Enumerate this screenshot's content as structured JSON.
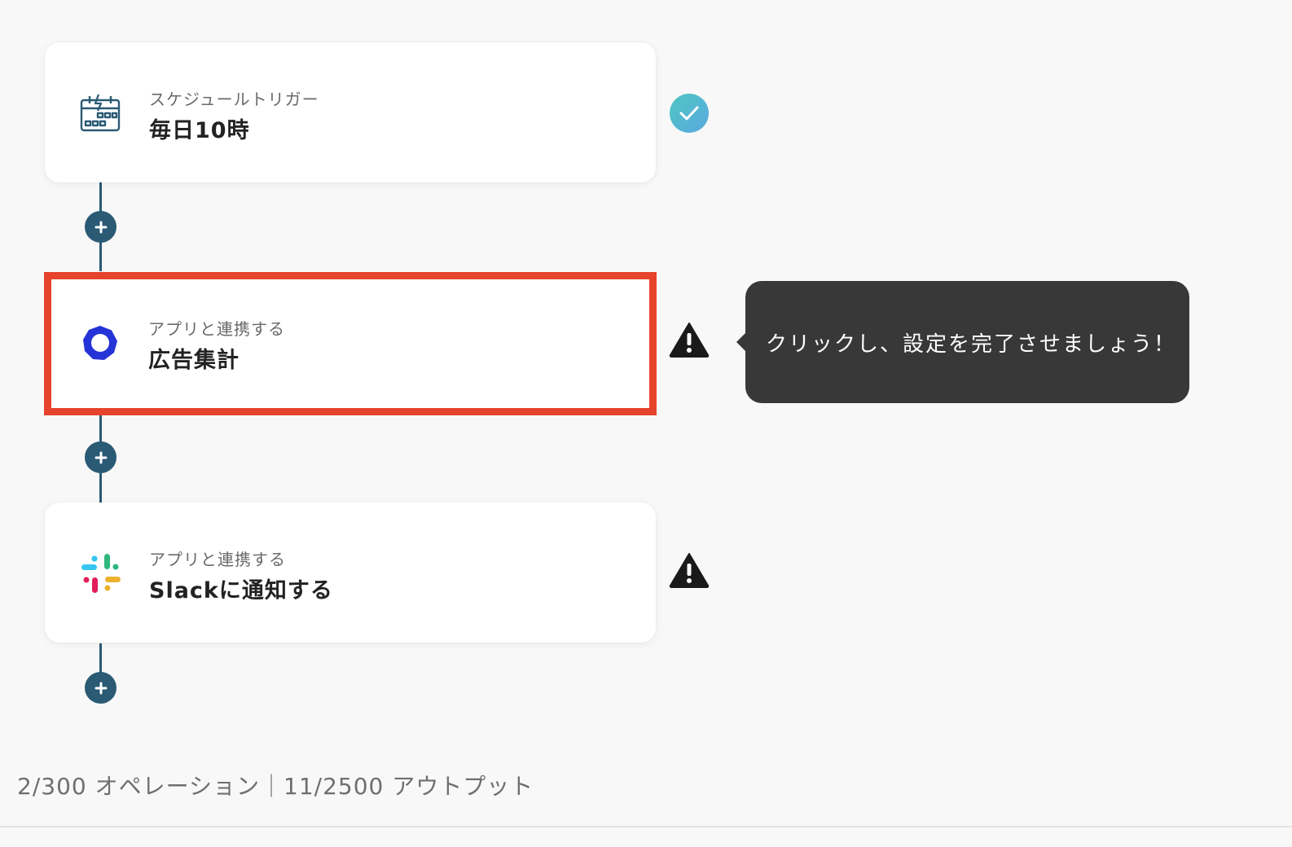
{
  "steps": [
    {
      "subtitle": "スケジュールトリガー",
      "title": "毎日10時",
      "icon": "calendar-icon",
      "status": "complete"
    },
    {
      "subtitle": "アプリと連携する",
      "title": "広告集計",
      "icon": "app-ring-icon",
      "status": "warning"
    },
    {
      "subtitle": "アプリと連携する",
      "title": "Slackに通知する",
      "icon": "slack-icon",
      "status": "warning"
    }
  ],
  "tooltip": {
    "text": "クリックし、設定を完了させましょう！"
  },
  "footer": {
    "usage": "2/300 オペレーション｜11/2500 アウトプット"
  },
  "colors": {
    "connector": "#2a5a74",
    "highlight": "#e5432b",
    "complete_start": "#4ec7c1",
    "complete_end": "#5aa8e0",
    "tooltip_bg": "#383838"
  }
}
